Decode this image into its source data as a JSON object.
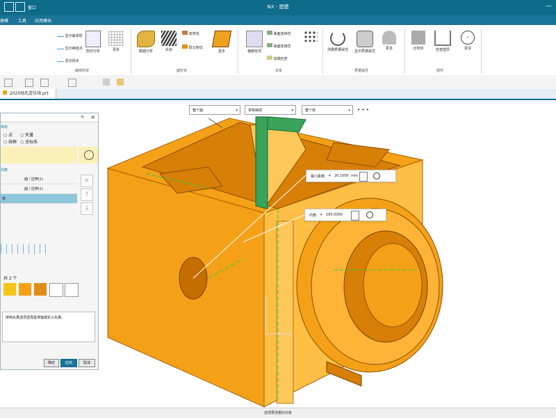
{
  "window": {
    "title": "NX - 建模",
    "menu_label": "窗口"
  },
  "menubar": {
    "items": [
      "建模",
      "工具",
      "应用模块"
    ]
  },
  "ribbon": {
    "buttons_a": [
      {
        "label": "显示曲率梳"
      },
      {
        "label": "显示峰值点"
      },
      {
        "label": "显示拐点"
      }
    ],
    "buttons_b": [
      {
        "label": "剖切分析"
      },
      {
        "label": "更多"
      }
    ],
    "buttons_c": [
      {
        "label": "截面分析"
      },
      {
        "label": "反射"
      },
      {
        "label": "高亮线"
      },
      {
        "label": "斑马条纹"
      },
      {
        "label": "更多"
      }
    ],
    "buttons_d": [
      {
        "label": "偏差检测"
      },
      {
        "label": "曲面连续性"
      },
      {
        "label": "曲面连接性"
      },
      {
        "label": "拔模检查"
      }
    ],
    "buttons_e": [
      {
        "label": "测量质量属性"
      },
      {
        "label": "显示质量属性"
      },
      {
        "label": "更多"
      }
    ],
    "buttons_f": [
      {
        "label": "比较体"
      },
      {
        "label": "检查壁厚"
      },
      {
        "label": "更多"
      }
    ],
    "groups": [
      "曲线形状",
      "面形状",
      "关系",
      "质量属性",
      "部件"
    ]
  },
  "file_tab": {
    "label": "2020钻孔定位块.prt"
  },
  "selection_bar": {
    "filter1": "整个面",
    "filter2": "单条曲线",
    "filter3": "整个体",
    "more": "• • •"
  },
  "dialog": {
    "section_title": "目标",
    "radio_point": "点",
    "radio_vector": "矢量",
    "radio_line": "线框",
    "radio_csys": "坐标系",
    "list_section": "列表",
    "list_rows": [
      {
        "name": "",
        "value": "面 / 拉伸(1)"
      },
      {
        "name": "",
        "value": "面 / 拉伸(1)"
      },
      {
        "name": "体",
        "value": ""
      }
    ],
    "count_label": "共 2 个",
    "info_text": "使用矢量选项选择基准轴或定义矢量。",
    "ok": "确定",
    "apply": "应用",
    "cancel": "取消"
  },
  "measure": {
    "min_label": "最小距离",
    "min_value": "20.1000",
    "min_unit": "mm",
    "angle_label": "内角",
    "angle_value": "180.0000"
  },
  "status": {
    "text": "选择要测量的对象"
  },
  "colors": {
    "accent": "#0f6b8a",
    "part": "#f5a118",
    "part_dark": "#d77f06",
    "part_light": "#ffbf45",
    "face_green": "#3aa35a"
  }
}
